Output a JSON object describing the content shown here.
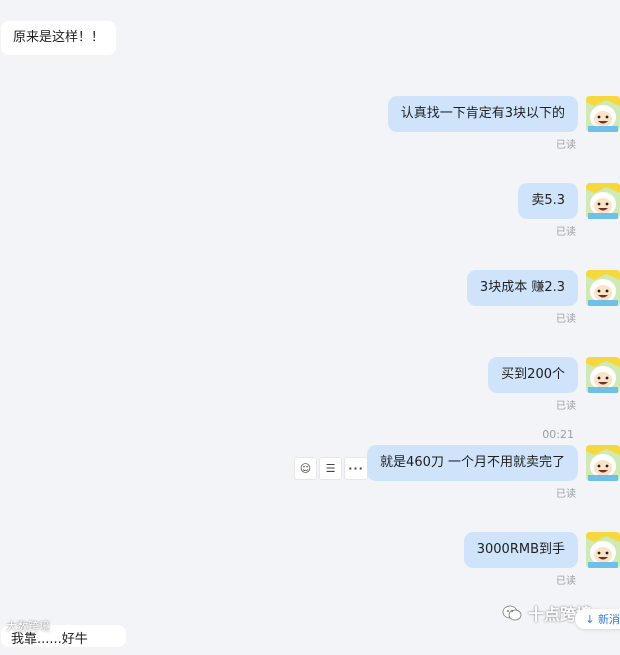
{
  "incoming_top": "原来是这样！！",
  "messages": [
    {
      "text": "认真找一下肯定有3块以下的",
      "status": "已读"
    },
    {
      "text": "卖5.3",
      "status": "已读"
    },
    {
      "text": "3块成本 赚2.3",
      "status": "已读"
    },
    {
      "text": "买到200个",
      "status": "已读"
    },
    {
      "text": "就是460刀 一个月不用就卖完了",
      "status": "已读"
    },
    {
      "text": "3000RMB到手",
      "status": "已读"
    }
  ],
  "timestamp": "00:21",
  "actions": {
    "more_label": "···"
  },
  "incoming_bottom": "我靠......好牛",
  "watermark_right": "十点跨境",
  "watermark_left": "大数跨境",
  "new_message": "新消",
  "colors": {
    "background": "#f3f4f7",
    "outgoing_bubble": "#cfe4fb",
    "incoming_bubble": "#ffffff",
    "status_text": "#9aa0a8"
  }
}
